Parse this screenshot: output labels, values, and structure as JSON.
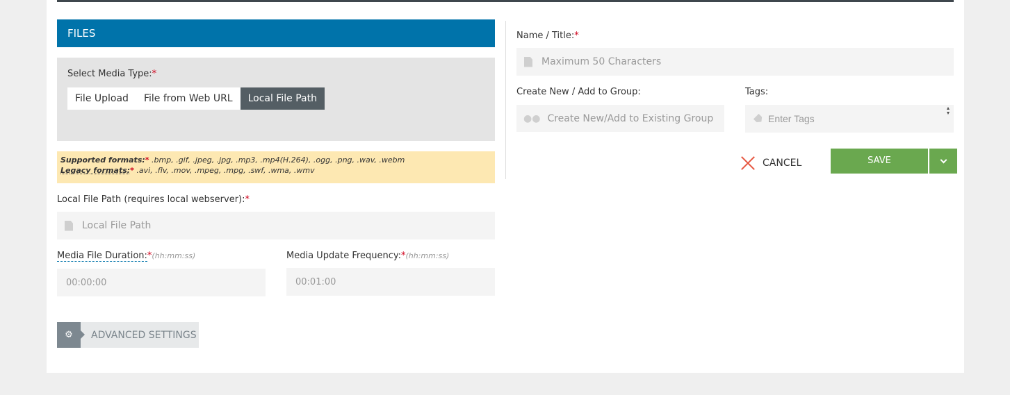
{
  "files": {
    "header": "FILES"
  },
  "media_type": {
    "label": "Select Media Type:",
    "required": "*",
    "options": [
      "File Upload",
      "File from Web URL",
      "Local File Path"
    ],
    "selected": "Local File Path"
  },
  "formats": {
    "supported_label": "Supported formats:",
    "supported_list": ".bmp, .gif, .jpeg, .jpg, .mp3, .mp4(H.264), .ogg, .png, .wav, .webm",
    "legacy_label": "Legacy formats:",
    "legacy_list": ".avi, .flv, .mov, .mpeg, .mpg, .swf, .wma, .wmv",
    "required": "*"
  },
  "local_path": {
    "label": "Local File Path (requires local webserver):",
    "required": "*",
    "placeholder": "Local File Path"
  },
  "duration": {
    "label": "Media File Duration:",
    "required": "*",
    "hint": "(hh:mm:ss)",
    "placeholder": "00:00:00"
  },
  "frequency": {
    "label": "Media Update Frequency:",
    "required": "*",
    "hint": "(hh:mm:ss)",
    "value": "00:01:00"
  },
  "advanced": {
    "label": "ADVANCED SETTINGS"
  },
  "name": {
    "label": "Name / Title:",
    "required": "*",
    "placeholder": "Maximum 50 Characters"
  },
  "group": {
    "label": "Create New / Add to Group:",
    "placeholder": "Create New/Add to Existing Group"
  },
  "tags": {
    "label": "Tags:",
    "placeholder": "Enter Tags"
  },
  "actions": {
    "cancel": "CANCEL",
    "save": "SAVE"
  }
}
